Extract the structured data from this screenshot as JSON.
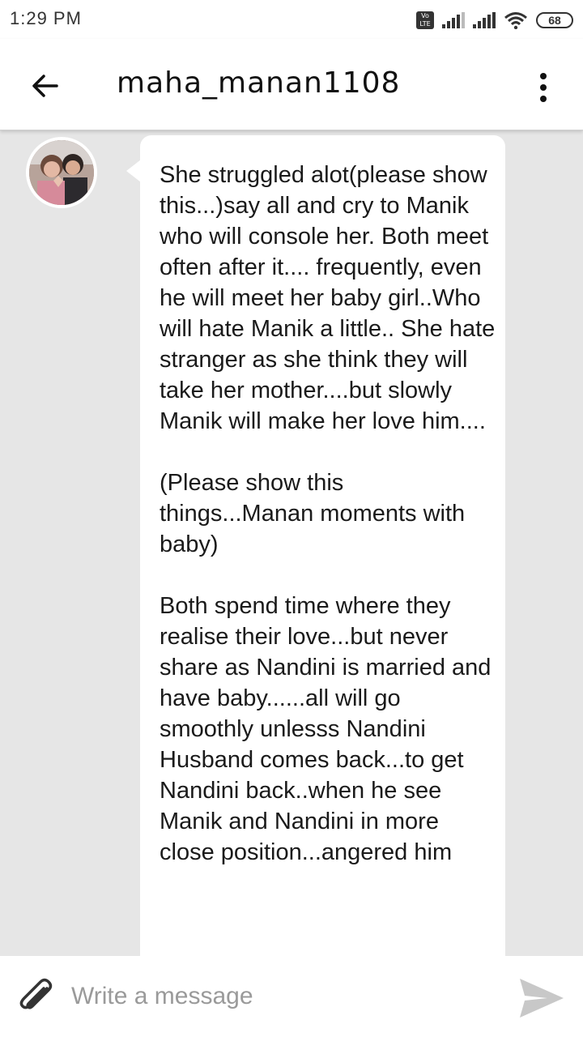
{
  "status_bar": {
    "time": "1:29 PM",
    "volte_label_top": "Vo",
    "volte_label_bottom": "LTE",
    "battery_level": "68",
    "icons": [
      "volte-icon",
      "signal-icon",
      "signal-icon",
      "wifi-icon",
      "battery-icon"
    ]
  },
  "header": {
    "title": "maha_manan1108",
    "back_icon": "arrow-left-icon",
    "menu_icon": "more-vertical-icon"
  },
  "conversation": {
    "messages": [
      {
        "sender_avatar": "avatar",
        "text": "She struggled alot(please show this...)say all and cry to Manik who will console her. Both meet often after it.... frequently, even he will meet her baby girl..Who will hate Manik a little.. She hate stranger as she think they will take her mother....but slowly Manik will make her love him....\n\n(Please show this things...Manan moments with baby)\n\nBoth spend time where they realise their love...but never share as Nandini is married and have baby......all will go smoothly unlesss Nandini Husband comes back...to get Nandini back..when he see Manik and Nandini in more close position...angered him"
      }
    ]
  },
  "composer": {
    "placeholder": "Write a message",
    "value": "",
    "attach_icon": "paperclip-icon",
    "send_icon": "send-icon"
  },
  "colors": {
    "conversation_background": "#e6e6e6",
    "bubble": "#ffffff",
    "send_icon": "#c8c8c8"
  }
}
